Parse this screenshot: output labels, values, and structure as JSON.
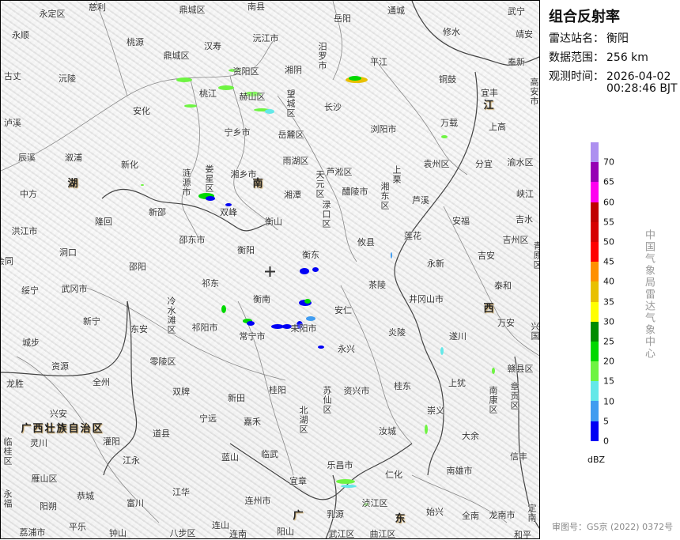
{
  "panel": {
    "title": "组合反射率",
    "station_label": "雷达站名：",
    "station_value": "衡阳",
    "range_label": "数据范围：",
    "range_value": "256 km",
    "time_label": "观测时间：",
    "time_date": "2026-04-02",
    "time_clock": "00:28:46 BJT",
    "organization": "中国气象局雷达气象中心",
    "approval_no": "审图号：GS京 (2022) 0372号"
  },
  "legend": {
    "unit": "dBZ",
    "ticks": [
      "70",
      "65",
      "60",
      "55",
      "50",
      "45",
      "40",
      "35",
      "30",
      "25",
      "20",
      "15",
      "10",
      "5",
      "0"
    ],
    "colors": [
      "#ad90f0",
      "#9600b4",
      "#ff00f0",
      "#c00000",
      "#d60000",
      "#ff0000",
      "#ff9000",
      "#e8c000",
      "#ffff00",
      "#008c00",
      "#00d800",
      "#6ef442",
      "#64e8e8",
      "#409cf0",
      "#0000f4"
    ]
  },
  "map": {
    "labels": [
      "永定区",
      "慈利",
      "鼎城区",
      "南县",
      "岳阳",
      "通城",
      "武宁",
      "永顺",
      "桃源",
      "汉寿",
      "沅江市",
      "修水",
      "靖安",
      "鼎城区",
      "汨罗市",
      "湘阴",
      "平江",
      "奉新",
      "古丈",
      "沅陵",
      "资阳区",
      "铜鼓",
      "宜丰",
      "高安市",
      "桃江",
      "赫山区",
      "望城区",
      "长沙",
      "安化",
      "泸溪",
      "宁乡市",
      "万载",
      "浏阳市",
      "上高",
      "岳麓区",
      "辰溪",
      "溆浦",
      "新化",
      "涟源市",
      "娄星区",
      "湘乡市",
      "雨湖区",
      "天元区",
      "芦淞区",
      "袁州区",
      "分宜",
      "渝水区",
      "上栗",
      "中方",
      "醴陵市",
      "湘东区",
      "芦溪",
      "峡江",
      "湘潭",
      "双峰",
      "新邵",
      "隆回",
      "渌口区",
      "安福",
      "吉水",
      "衡山",
      "洪江市",
      "邵东市",
      "攸县",
      "莲花",
      "吉州区",
      "洞口",
      "衡阳",
      "衡东",
      "吉安",
      "永新",
      "青原区",
      "会同",
      "邵阳",
      "茶陵",
      "泰和",
      "绥宁",
      "武冈市",
      "祁东",
      "井冈山市",
      "衡南",
      "安仁",
      "万安",
      "新宁",
      "东安",
      "冷水滩区",
      "祁阳市",
      "耒阳市",
      "炎陵",
      "遂川",
      "兴国",
      "常宁市",
      "城步",
      "永兴",
      "零陵区",
      "资源",
      "赣县区",
      "龙胜",
      "全州",
      "桂东",
      "上犹",
      "资兴市",
      "双牌",
      "新田",
      "苏仙区",
      "南康区",
      "章贡区",
      "桂阳",
      "兴安",
      "宁远",
      "嘉禾",
      "北湖区",
      "崇义",
      "汝城",
      "道县",
      "大余",
      "灵川",
      "灌阳",
      "临桂区",
      "临武",
      "蓝山",
      "江永",
      "信丰",
      "乐昌市",
      "仁化",
      "南雄市",
      "雁山区",
      "宜章",
      "江华",
      "恭城",
      "富川",
      "连州市",
      "永福",
      "阳朔",
      "浈江区",
      "始兴",
      "乳源",
      "全南",
      "龙南市",
      "定南",
      "平乐",
      "荔浦市",
      "钟山",
      "八步区",
      "连山",
      "连南",
      "阳山",
      "武江区",
      "曲江区",
      "和平"
    ],
    "province_labels": [
      "湖",
      "南",
      "江",
      "西",
      "广",
      "东",
      "广西壮族自治区"
    ]
  }
}
